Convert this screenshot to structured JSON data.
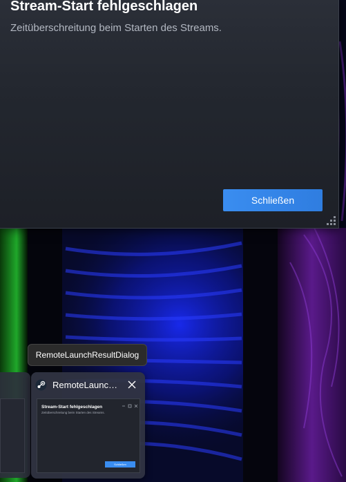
{
  "dialog": {
    "title": "Stream-Start fehlgeschlagen",
    "message": "Zeitüberschreitung beim Starten des Streams.",
    "close_label": "Schließen"
  },
  "tooltip": {
    "text": "RemoteLaunchResultDialog"
  },
  "taskbar_preview": {
    "title": "RemoteLaunc…",
    "app_icon": "steam-icon",
    "close_icon": "close-icon",
    "thumbnail": {
      "title": "Stream-Start fehlgeschlagen",
      "message": "Zeitüberschreitung beim Starten des Streams.",
      "button_label": "Schließen"
    }
  },
  "colors": {
    "accent_button": "#3a8df0",
    "dialog_bg": "#23272f",
    "title_text": "#ffffff",
    "message_text": "#b3b8c2"
  }
}
